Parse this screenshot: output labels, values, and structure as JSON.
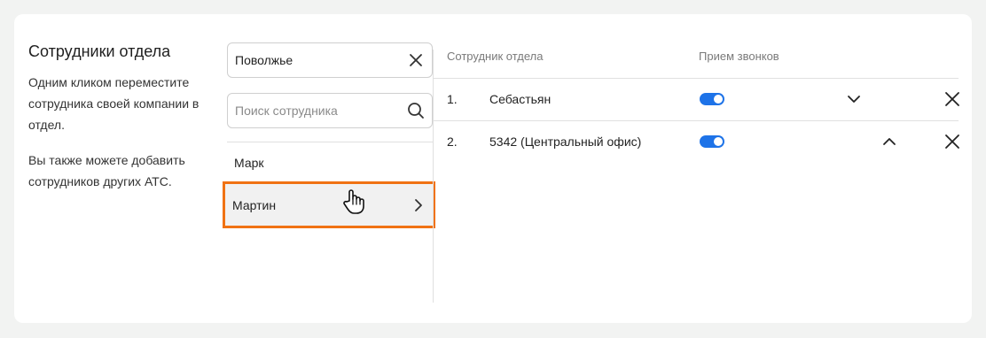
{
  "section": {
    "title": "Сотрудники отдела",
    "description_1": "Одним кликом переместите сотрудника своей компании в отдел.",
    "description_2": "Вы также можете добавить сотрудников других АТС."
  },
  "department_field": {
    "value": "Поволжье"
  },
  "search_field": {
    "placeholder": "Поиск сотрудника"
  },
  "available_employees": [
    {
      "name": "Марк"
    },
    {
      "name": "Мартин"
    }
  ],
  "table": {
    "headers": {
      "employee": "Сотрудник отдела",
      "calls": "Прием звонков"
    },
    "rows": [
      {
        "num": "1.",
        "name": "Себастьян",
        "calls_enabled": true,
        "expand": "chevron-down"
      },
      {
        "num": "2.",
        "name": "5342 (Центральный офис)",
        "calls_enabled": true,
        "expand": "chevron-up"
      }
    ]
  },
  "colors": {
    "accent": "#1e73e8",
    "highlight": "#f07213"
  }
}
